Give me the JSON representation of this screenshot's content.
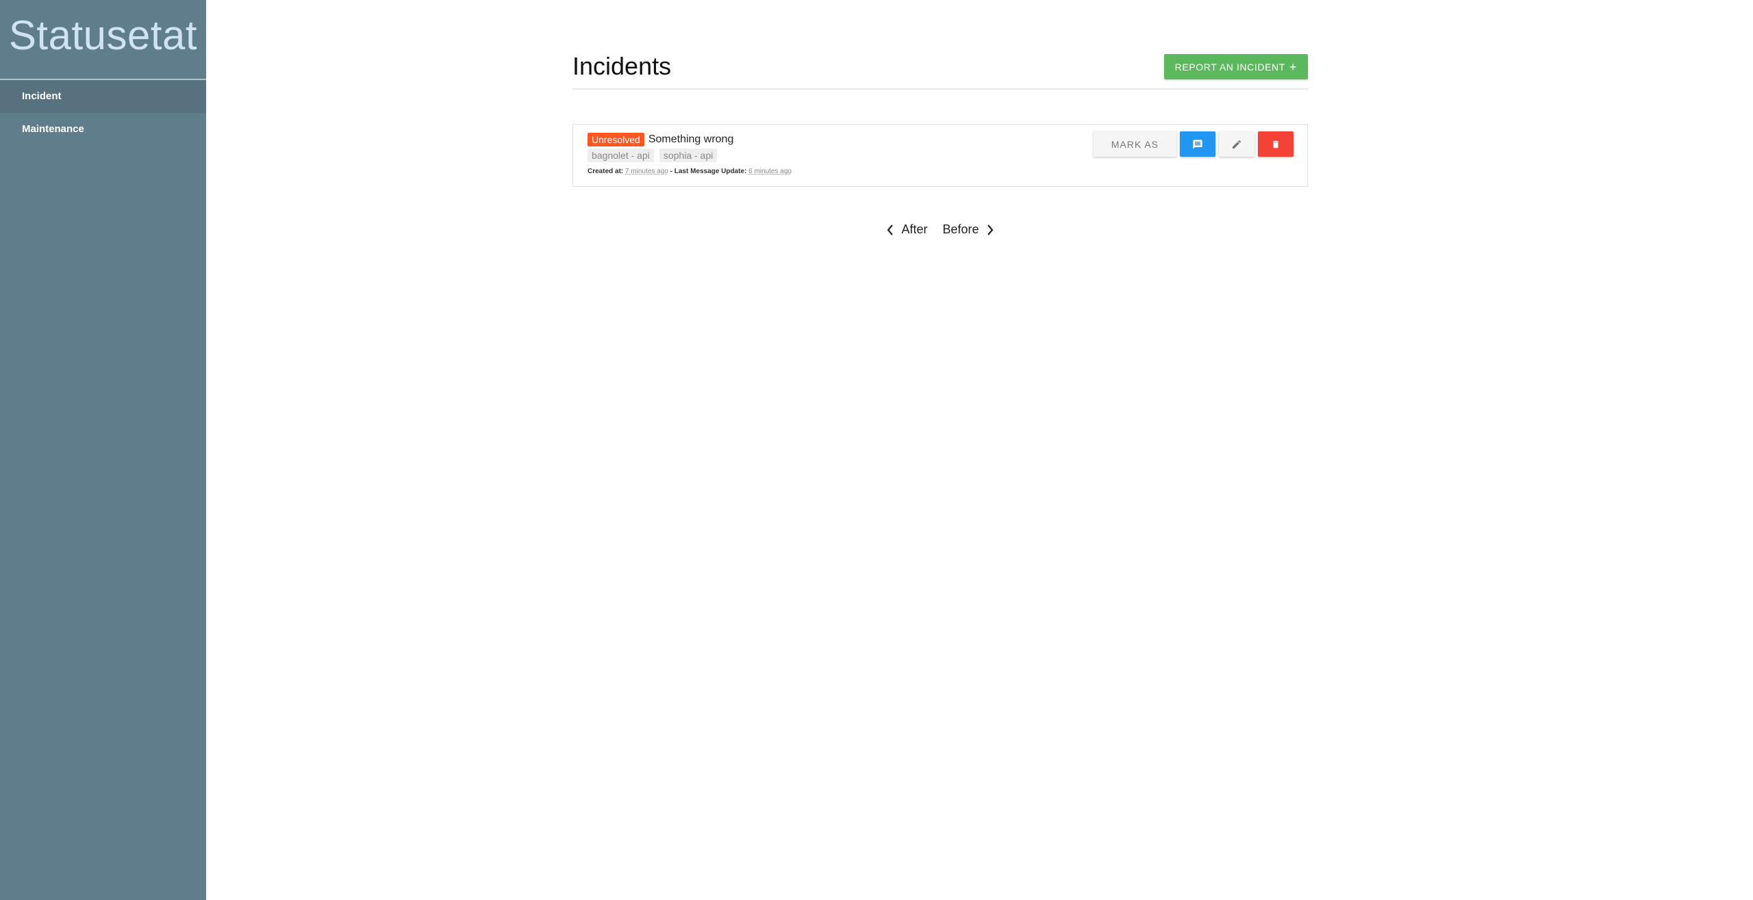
{
  "sidebar": {
    "brand": "Statusetat",
    "items": [
      {
        "label": "Incident",
        "active": true
      },
      {
        "label": "Maintenance",
        "active": false
      }
    ],
    "background": "#607d8b"
  },
  "header": {
    "title": "Incidents",
    "report_button": "REPORT AN INCIDENT",
    "report_icon": "plus-icon"
  },
  "incidents": [
    {
      "status": "Unresolved",
      "status_color": "#ff5722",
      "title": "Something wrong",
      "tags": [
        "bagnolet - api",
        "sophia - api"
      ],
      "created_label": "Created at:",
      "created_value": "7 minutes ago",
      "separator": " - ",
      "updated_label": "Last Message Update:",
      "updated_value": "6 minutes ago",
      "actions": {
        "mark_as": "MARK AS",
        "message_icon": "comment-icon",
        "edit_icon": "pencil-icon",
        "delete_icon": "trash-icon"
      }
    }
  ],
  "pagination": {
    "prev_label": "After",
    "next_label": "Before"
  }
}
